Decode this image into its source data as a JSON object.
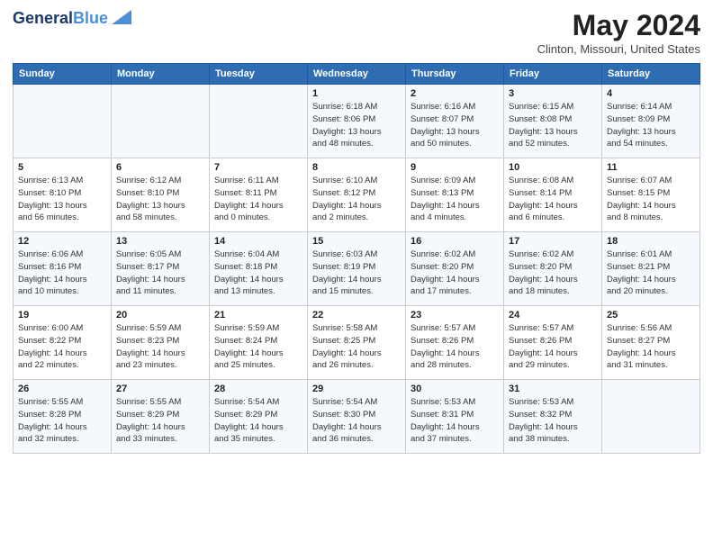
{
  "logo": {
    "line1": "General",
    "line2": "Blue"
  },
  "title": "May 2024",
  "subtitle": "Clinton, Missouri, United States",
  "days_of_week": [
    "Sunday",
    "Monday",
    "Tuesday",
    "Wednesday",
    "Thursday",
    "Friday",
    "Saturday"
  ],
  "weeks": [
    [
      {
        "num": "",
        "info": ""
      },
      {
        "num": "",
        "info": ""
      },
      {
        "num": "",
        "info": ""
      },
      {
        "num": "1",
        "info": "Sunrise: 6:18 AM\nSunset: 8:06 PM\nDaylight: 13 hours\nand 48 minutes."
      },
      {
        "num": "2",
        "info": "Sunrise: 6:16 AM\nSunset: 8:07 PM\nDaylight: 13 hours\nand 50 minutes."
      },
      {
        "num": "3",
        "info": "Sunrise: 6:15 AM\nSunset: 8:08 PM\nDaylight: 13 hours\nand 52 minutes."
      },
      {
        "num": "4",
        "info": "Sunrise: 6:14 AM\nSunset: 8:09 PM\nDaylight: 13 hours\nand 54 minutes."
      }
    ],
    [
      {
        "num": "5",
        "info": "Sunrise: 6:13 AM\nSunset: 8:10 PM\nDaylight: 13 hours\nand 56 minutes."
      },
      {
        "num": "6",
        "info": "Sunrise: 6:12 AM\nSunset: 8:10 PM\nDaylight: 13 hours\nand 58 minutes."
      },
      {
        "num": "7",
        "info": "Sunrise: 6:11 AM\nSunset: 8:11 PM\nDaylight: 14 hours\nand 0 minutes."
      },
      {
        "num": "8",
        "info": "Sunrise: 6:10 AM\nSunset: 8:12 PM\nDaylight: 14 hours\nand 2 minutes."
      },
      {
        "num": "9",
        "info": "Sunrise: 6:09 AM\nSunset: 8:13 PM\nDaylight: 14 hours\nand 4 minutes."
      },
      {
        "num": "10",
        "info": "Sunrise: 6:08 AM\nSunset: 8:14 PM\nDaylight: 14 hours\nand 6 minutes."
      },
      {
        "num": "11",
        "info": "Sunrise: 6:07 AM\nSunset: 8:15 PM\nDaylight: 14 hours\nand 8 minutes."
      }
    ],
    [
      {
        "num": "12",
        "info": "Sunrise: 6:06 AM\nSunset: 8:16 PM\nDaylight: 14 hours\nand 10 minutes."
      },
      {
        "num": "13",
        "info": "Sunrise: 6:05 AM\nSunset: 8:17 PM\nDaylight: 14 hours\nand 11 minutes."
      },
      {
        "num": "14",
        "info": "Sunrise: 6:04 AM\nSunset: 8:18 PM\nDaylight: 14 hours\nand 13 minutes."
      },
      {
        "num": "15",
        "info": "Sunrise: 6:03 AM\nSunset: 8:19 PM\nDaylight: 14 hours\nand 15 minutes."
      },
      {
        "num": "16",
        "info": "Sunrise: 6:02 AM\nSunset: 8:20 PM\nDaylight: 14 hours\nand 17 minutes."
      },
      {
        "num": "17",
        "info": "Sunrise: 6:02 AM\nSunset: 8:20 PM\nDaylight: 14 hours\nand 18 minutes."
      },
      {
        "num": "18",
        "info": "Sunrise: 6:01 AM\nSunset: 8:21 PM\nDaylight: 14 hours\nand 20 minutes."
      }
    ],
    [
      {
        "num": "19",
        "info": "Sunrise: 6:00 AM\nSunset: 8:22 PM\nDaylight: 14 hours\nand 22 minutes."
      },
      {
        "num": "20",
        "info": "Sunrise: 5:59 AM\nSunset: 8:23 PM\nDaylight: 14 hours\nand 23 minutes."
      },
      {
        "num": "21",
        "info": "Sunrise: 5:59 AM\nSunset: 8:24 PM\nDaylight: 14 hours\nand 25 minutes."
      },
      {
        "num": "22",
        "info": "Sunrise: 5:58 AM\nSunset: 8:25 PM\nDaylight: 14 hours\nand 26 minutes."
      },
      {
        "num": "23",
        "info": "Sunrise: 5:57 AM\nSunset: 8:26 PM\nDaylight: 14 hours\nand 28 minutes."
      },
      {
        "num": "24",
        "info": "Sunrise: 5:57 AM\nSunset: 8:26 PM\nDaylight: 14 hours\nand 29 minutes."
      },
      {
        "num": "25",
        "info": "Sunrise: 5:56 AM\nSunset: 8:27 PM\nDaylight: 14 hours\nand 31 minutes."
      }
    ],
    [
      {
        "num": "26",
        "info": "Sunrise: 5:55 AM\nSunset: 8:28 PM\nDaylight: 14 hours\nand 32 minutes."
      },
      {
        "num": "27",
        "info": "Sunrise: 5:55 AM\nSunset: 8:29 PM\nDaylight: 14 hours\nand 33 minutes."
      },
      {
        "num": "28",
        "info": "Sunrise: 5:54 AM\nSunset: 8:29 PM\nDaylight: 14 hours\nand 35 minutes."
      },
      {
        "num": "29",
        "info": "Sunrise: 5:54 AM\nSunset: 8:30 PM\nDaylight: 14 hours\nand 36 minutes."
      },
      {
        "num": "30",
        "info": "Sunrise: 5:53 AM\nSunset: 8:31 PM\nDaylight: 14 hours\nand 37 minutes."
      },
      {
        "num": "31",
        "info": "Sunrise: 5:53 AM\nSunset: 8:32 PM\nDaylight: 14 hours\nand 38 minutes."
      },
      {
        "num": "",
        "info": ""
      }
    ]
  ]
}
